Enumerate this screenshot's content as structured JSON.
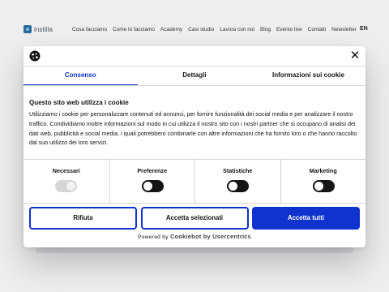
{
  "site": {
    "logo_text": "instilla",
    "nav": [
      "Cosa facciamo",
      "Come lo facciamo",
      "Academy",
      "Casi studio",
      "Lavora con noi",
      "Blog",
      "Evento live",
      "Contatti",
      "Newsletter"
    ],
    "lang": "EN"
  },
  "dialog": {
    "close_icon": "close-icon",
    "tabs": [
      {
        "label": "Consenso",
        "active": true
      },
      {
        "label": "Dettagli",
        "active": false
      },
      {
        "label": "Informazioni sui cookie",
        "active": false
      }
    ],
    "title": "Questo sito web utilizza i cookie",
    "text": "Utilizziamo i cookie per personalizzare contenuti ed annunci, per fornire funzionalità dei social media e per analizzare il nostro traffico. Condividiamo inoltre informazioni sul modo in cui utilizza il nostro sito con i nostri partner che si occupano di analisi dei dati web, pubblicità e social media, i quali potrebbero combinarle con altre informazioni che ha fornito loro o che hanno raccolto dal suo utilizzo dei loro servizi.",
    "categories": [
      {
        "label": "Necessari",
        "enabled": true,
        "locked": true
      },
      {
        "label": "Preferenze",
        "enabled": false,
        "locked": false
      },
      {
        "label": "Statistiche",
        "enabled": false,
        "locked": false
      },
      {
        "label": "Marketing",
        "enabled": false,
        "locked": false
      }
    ],
    "buttons": {
      "reject": "Rifiuta",
      "accept_selected": "Accetta selezionati",
      "accept_all": "Accetta tutti"
    },
    "powered_prefix": "Powered by",
    "powered_brand": "Cookiebot by Usercentrics"
  },
  "colors": {
    "accent": "#1032cf",
    "text": "#141414",
    "toggle_on": "#141414",
    "toggle_disabled": "#d6d6d6"
  }
}
